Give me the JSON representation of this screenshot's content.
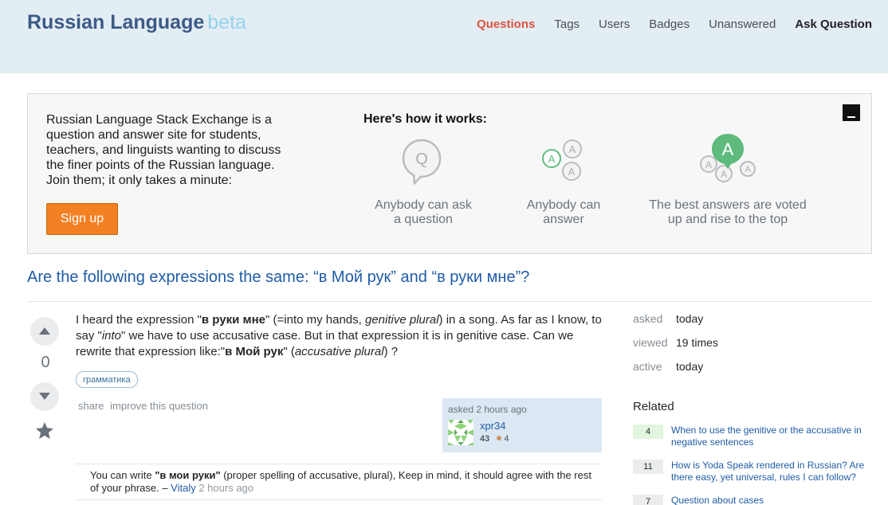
{
  "site": {
    "name": "Russian Language",
    "badge": "beta"
  },
  "nav": {
    "items": [
      "Questions",
      "Tags",
      "Users",
      "Badges",
      "Unanswered"
    ],
    "ask": "Ask Question",
    "active": "Questions"
  },
  "welcome": {
    "text": "Russian Language Stack Exchange is a question and answer site for students, teachers, and linguists wanting to discuss the finer points of the Russian language. Join them; it only takes a minute:",
    "signup": "Sign up",
    "how_title": "Here's how it works:",
    "steps": [
      {
        "icon": "question-bubble-icon",
        "line1": "Anybody can ask",
        "line2": "a question"
      },
      {
        "icon": "answers-bubbles-icon",
        "line1": "Anybody can",
        "line2": "answer"
      },
      {
        "icon": "best-answer-icon",
        "line1": "The best answers are voted",
        "line2": "up and rise to the top"
      }
    ]
  },
  "question": {
    "title": "Are the following expressions the same: “в Мой рук” and “в руки мне”?",
    "votes": "0",
    "body": {
      "p1": "I heard the expression \"",
      "b1": "в руки мне",
      "p2": "\" (=into my hands, ",
      "i1": "genitive plural",
      "p3": ") in a song. As far as I know, to say \"",
      "i2": "into",
      "p4": "\" we have to use accusative case. But in that expression it is in genitive case. Can we rewrite that expression like:\"",
      "b2": "в Мой рук",
      "p5": "\" (",
      "i3": "accusative plural",
      "p6": ") ?"
    },
    "tag": "грамматика",
    "menu": {
      "share": "share",
      "improve": "improve this question"
    },
    "owner": {
      "asked": "asked 2 hours ago",
      "name": "xpr34",
      "rep": "43",
      "bronze": "4"
    }
  },
  "comment": {
    "p1": "You can write ",
    "b1": "\"в мои руки\"",
    "p2": " (proper spelling of accusative, plural), Keep in mind, it should agree with the rest of your phrase. – ",
    "user": "Vitaly",
    "time": " 2 hours ago"
  },
  "meta": {
    "asked_label": "asked",
    "asked": "today",
    "viewed_label": "viewed",
    "viewed": "19 times",
    "active_label": "active",
    "active": "today"
  },
  "related": {
    "title": "Related",
    "items": [
      {
        "score": "4",
        "answered": true,
        "title": "When to use the genitive or the accusative in negative sentences"
      },
      {
        "score": "11",
        "answered": false,
        "title": "How is Yoda Speak rendered in Russian? Are there easy, yet universal, rules I can follow?"
      },
      {
        "score": "7",
        "answered": false,
        "title": "Question about cases"
      }
    ]
  },
  "colors": {
    "accent": "#f48024",
    "link": "#1f5ca8",
    "nav_active": "#e0533e",
    "header_bg": "#e3edf4"
  }
}
